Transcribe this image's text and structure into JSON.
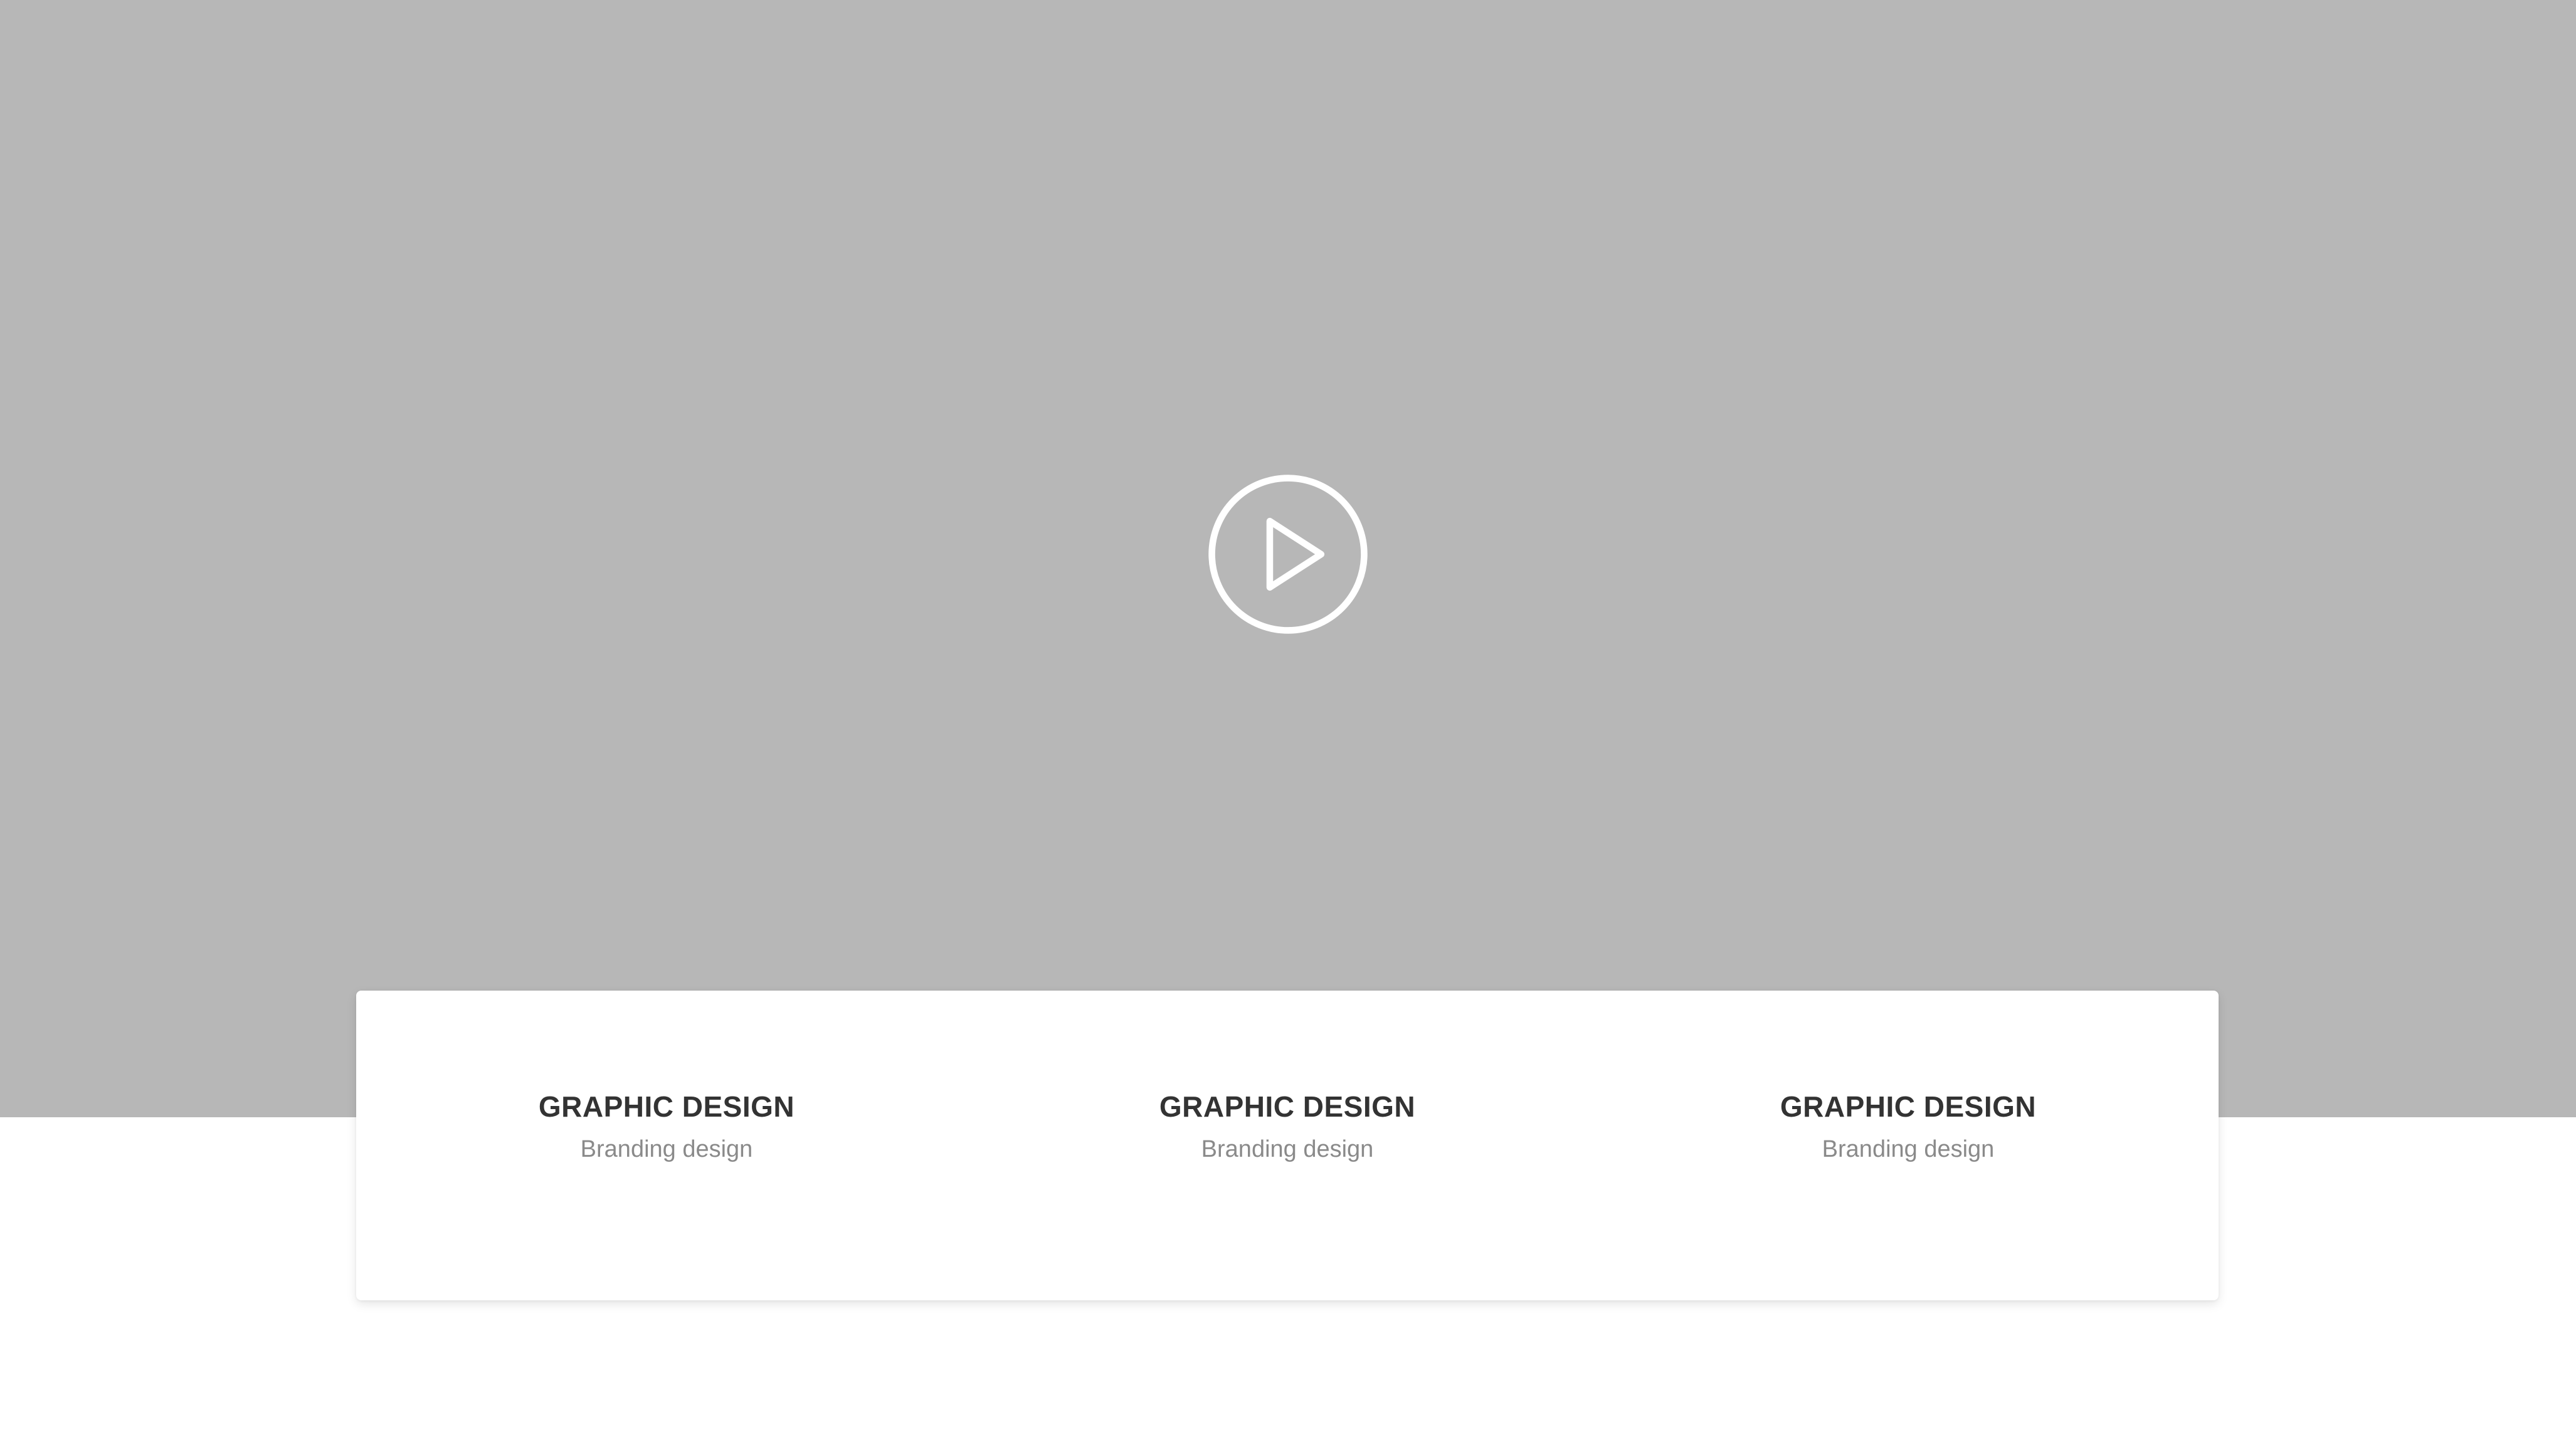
{
  "hero": {
    "background_color": "#b7b7b7",
    "play_icon": "play-circle-icon"
  },
  "services": [
    {
      "title": "GRAPHIC DESIGN",
      "subtitle": "Branding design"
    },
    {
      "title": "GRAPHIC DESIGN",
      "subtitle": "Branding design"
    },
    {
      "title": "GRAPHIC DESIGN",
      "subtitle": "Branding design"
    }
  ]
}
